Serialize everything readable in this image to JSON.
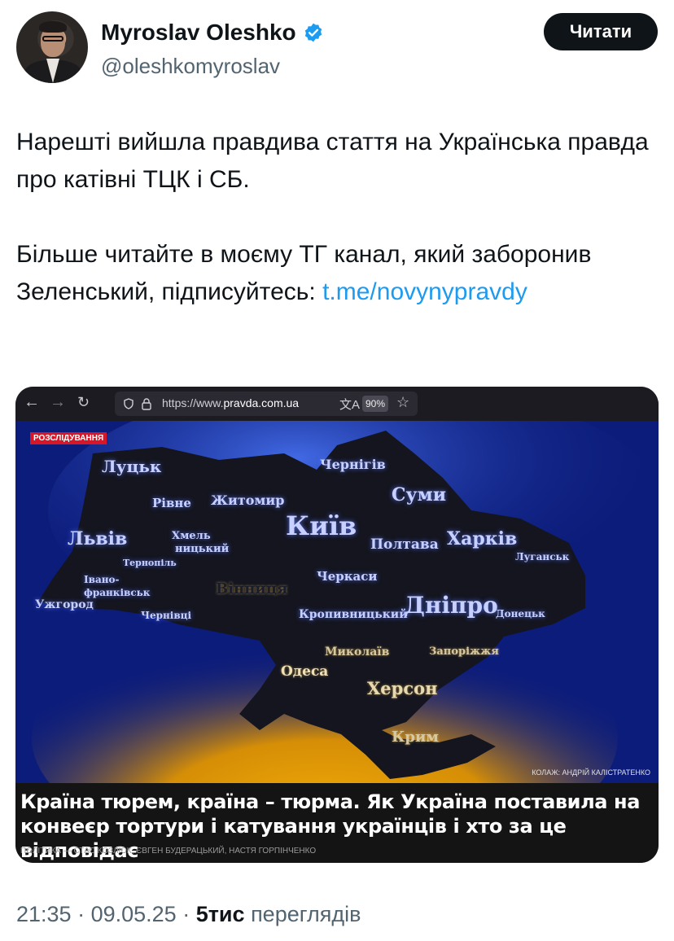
{
  "author": {
    "name": "Myroslav Oleshko",
    "handle": "@oleshkomyroslav",
    "follow_label": "Читати"
  },
  "tweet": {
    "line1": "Нарешті вийшла правдива стаття на Українська правда про катівні ТЦК і СБ.",
    "line2_text": "Більше читайте в моєму ТГ канал, який заборонив Зеленський, підписуйтесь: ",
    "line2_link": "t.me/​novynypravdy"
  },
  "card": {
    "url_prefix": "https://www.",
    "url_domain": "pravda.com.ua",
    "zoom": "90%",
    "tag": "РОЗСЛІДУВАННЯ",
    "credit": "КОЛАЖ: АНДРІЙ КАЛІСТРАТЕНКО",
    "cities": {
      "lutsk": "Луцьк",
      "rivne": "Рівне",
      "zhytomyr": "Житомир",
      "chernihiv": "Чернігів",
      "sumy": "Суми",
      "kyiv": "Київ",
      "lviv": "Львів",
      "khmel1": "Хмель",
      "khmel2": "ницький",
      "ternopil": "Тернопіль",
      "poltava": "Полтава",
      "kharkiv": "Харків",
      "luhansk": "Луганськ",
      "ivano1": "Івано-",
      "ivano2": "франківськ",
      "vinnytsia": "Вінниця",
      "cherkasy": "Черкаси",
      "uzhhorod": "Ужгород",
      "chernivtsi": "Чернівці",
      "kropyvnytskyi": "Кропивницький",
      "dnipro": "Дніпро",
      "donetsk": "Донецьк",
      "mykolaiv": "Миколаїв",
      "zaporizhzhia": "Запоріжжя",
      "odesa": "Одеса",
      "kherson": "Херсон",
      "krym": "Крим"
    },
    "headline": "Країна тюрем, країна – тюрма. Як Україна поставила на конвеєр тортури і катування українців і хто за це відповідає",
    "byline": "ПОЛІТИКА — СТАС КОЗЛЮК, ЄВГЕН БУДЕРАЦЬКИЙ, НАСТЯ ГОРПІНЧЕНКО"
  },
  "meta": {
    "time": "21:35",
    "date": "09.05.25",
    "views_count": "5тис",
    "views_label": "переглядів"
  },
  "colors": {
    "link": "#1d9bf0",
    "verified": "#1d9bf0",
    "map_bg": "#0e1f82",
    "glow": "#ffb800"
  }
}
